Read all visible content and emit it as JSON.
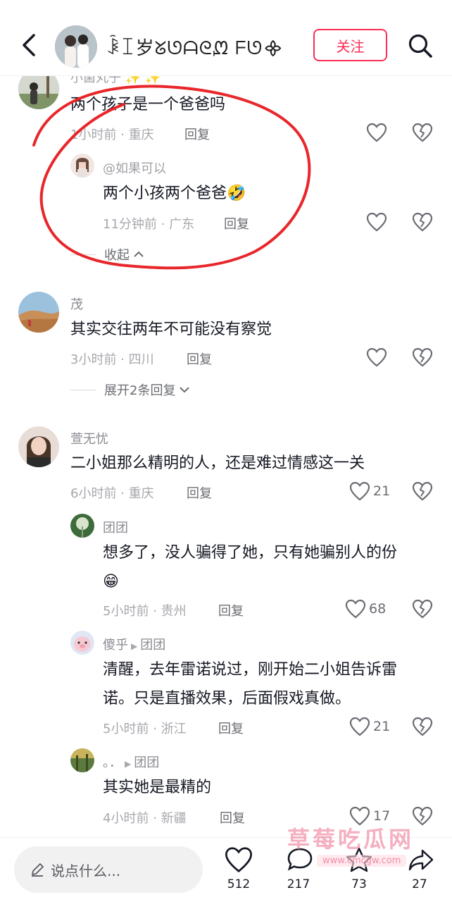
{
  "header": {
    "username": "ꀳꀤ岁ᘜᘎᗩᘓᘻ ᖴᘎ᯽",
    "follow_label": "关注",
    "icons": {
      "back": "back-arrow-icon",
      "search": "search-icon"
    }
  },
  "comments": [
    {
      "username": "小菌丸子 ✨ ✨",
      "text": "两个孩子是一个爸爸吗",
      "time": "1小时前 · 重庆",
      "reply_label": "回复",
      "likes": "",
      "replies": [
        {
          "username": "@如果可以",
          "text": "两个小孩两个爸爸🤣",
          "time": "11分钟前 · 广东",
          "reply_label": "回复",
          "likes": ""
        }
      ],
      "collapse_label": "收起"
    },
    {
      "username": "茂",
      "text": "其实交往两年不可能没有察觉",
      "time": "3小时前 · 四川",
      "reply_label": "回复",
      "likes": "",
      "expand_label": "展开2条回复"
    },
    {
      "username": "萱无忧",
      "text": "二小姐那么精明的人，还是难过情感这一关",
      "time": "6小时前 · 重庆",
      "reply_label": "回复",
      "likes": "21",
      "replies": [
        {
          "username": "团团",
          "text": "想多了，没人骗得了她，只有她骗别人的份",
          "emoji": "😁",
          "time": "5小时前 · 贵州",
          "reply_label": "回复",
          "likes": "68"
        },
        {
          "username": "傻乎",
          "reply_to": "团团",
          "text_line1": "清醒，去年雷诺说过，刚开始二小姐告诉雷",
          "text_line2": "诺。只是直播效果，后面假戏真做。",
          "time": "5小时前 · 浙江",
          "reply_label": "回复",
          "likes": "21"
        },
        {
          "username": "。．",
          "reply_to": "团团",
          "text": "其实她是最精的",
          "time": "4小时前 · 新疆",
          "reply_label": "回复",
          "likes": "17"
        }
      ]
    }
  ],
  "bottom_bar": {
    "input_placeholder": "说点什么...",
    "likes": "512",
    "comments": "217",
    "favorites": "73",
    "shares": "27"
  },
  "watermark": {
    "text": "草莓吃瓜网",
    "url": "www.cmcgw.com"
  },
  "colors": {
    "accent": "#fe2c55",
    "annotation": "#e8262b"
  }
}
